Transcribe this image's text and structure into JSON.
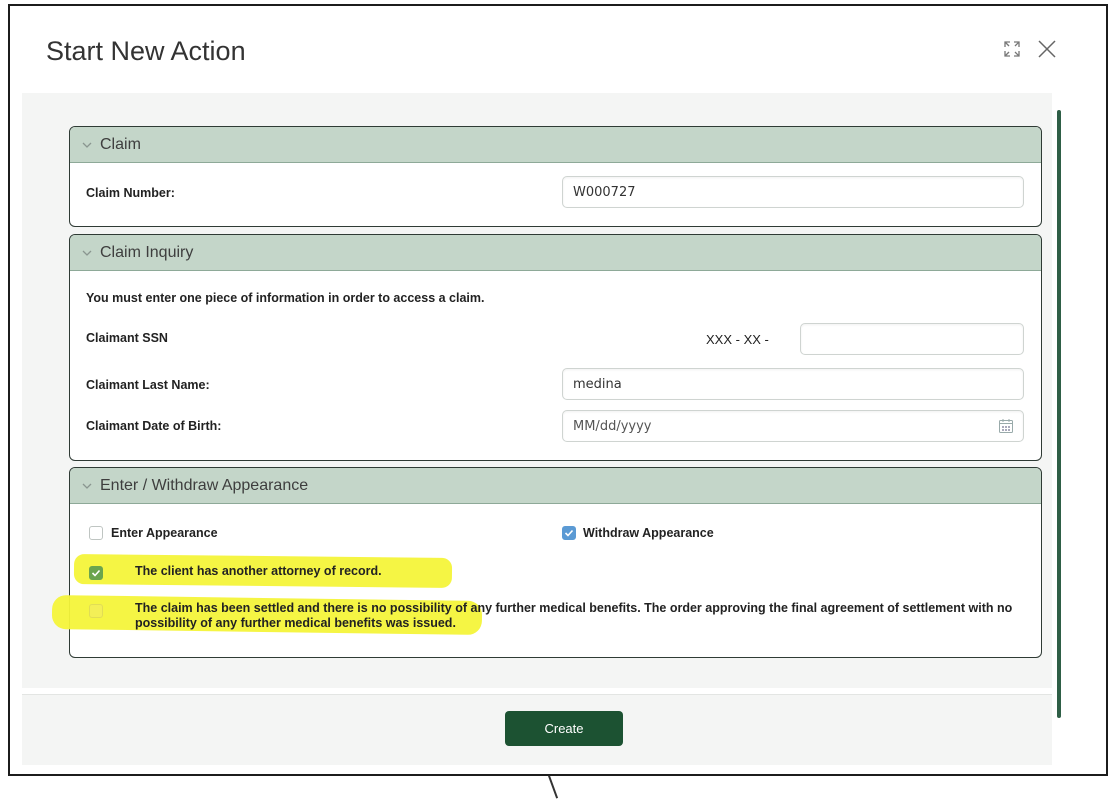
{
  "dialog": {
    "title": "Start New Action",
    "icons": [
      "expand-icon",
      "close-icon"
    ]
  },
  "claim": {
    "header": "Claim",
    "claim_number_label": "Claim Number:",
    "claim_number_value": "W000727"
  },
  "inquiry": {
    "header": "Claim Inquiry",
    "instruction": "You must enter one piece of information in order to access a claim.",
    "ssn_label": "Claimant SSN",
    "ssn_prefix": "XXX - XX -",
    "ssn_value": "",
    "last_name_label": "Claimant Last Name:",
    "last_name_value": "medina",
    "dob_label": "Claimant Date of Birth:",
    "dob_placeholder": "MM/dd/yyyy"
  },
  "appearance": {
    "header": "Enter / Withdraw Appearance",
    "enter_label": "Enter Appearance",
    "enter_checked": false,
    "withdraw_label": "Withdraw Appearance",
    "withdraw_checked": true,
    "option_other_attorney": "The client has another attorney of record.",
    "option_other_attorney_checked": true,
    "option_settled": "The claim has been settled and there is no possibility of any further medical benefits. The order approving the final agreement of settlement with no possibility of any further medical benefits was issued.",
    "option_settled_checked": false
  },
  "footer": {
    "create_label": "Create"
  },
  "colors": {
    "section_header_bg": "#c4d6c9",
    "primary_button": "#1c5232",
    "highlight": "#f4f43a",
    "checkbox_blue": "#5b9ad4"
  }
}
